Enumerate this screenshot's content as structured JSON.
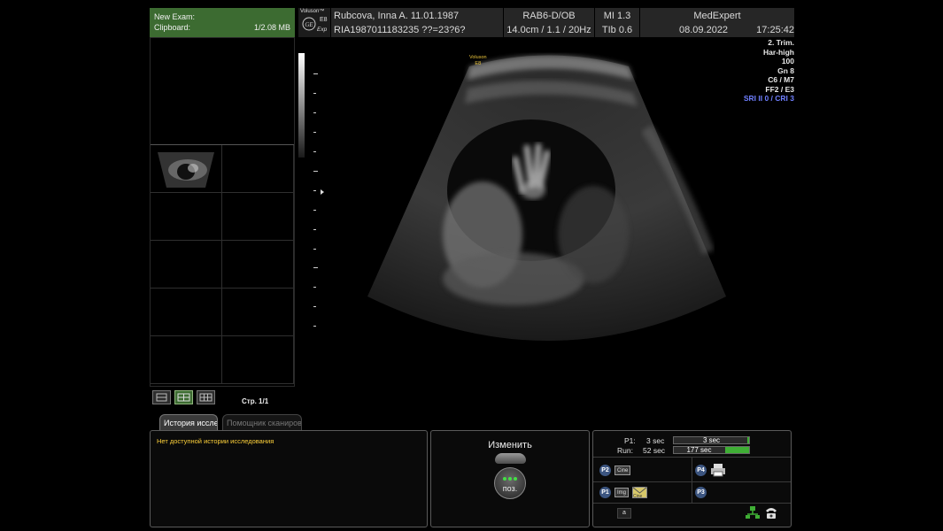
{
  "clipboard": {
    "title": "New Exam:",
    "label": "Clipboard:",
    "size": "1/2.08 MB",
    "page_label": "Стр. 1/1"
  },
  "header": {
    "brand": "Voluson™",
    "model": "E8",
    "model_sub": "Exp",
    "patient_name": "Rubcova, Inna A.  11.01.1987",
    "patient_id": "RIA1987011183235  ??=23?6?",
    "probe": "RAB6-D/OB",
    "depth": "14.0cm / 1.1 / 20Hz",
    "mi": "MI  1.3",
    "tib": "TIb  0.6",
    "institution": "MedExpert",
    "date": "08.09.2022",
    "time": "17:25:42"
  },
  "params": {
    "p1": "2. Trim.",
    "p2": "Har-high",
    "p3": "100",
    "p4": "Gn   8",
    "p5": "C6 / M7",
    "p6": "FF2 / E3",
    "p7": "SRI II 0 / CRI 3"
  },
  "image_label": {
    "l1": "Voluson",
    "l2": "E8"
  },
  "tabs": {
    "history": "История исслед",
    "helper": "Помощник сканиров"
  },
  "history": {
    "message": "Нет доступной истории исследования"
  },
  "change": {
    "title": "Изменить",
    "knob": "поз."
  },
  "info": {
    "p1_label": "P1:",
    "p1_val": "3 sec",
    "p1_bar": "3 sec",
    "run_label": "Run:",
    "run_val": "52 sec",
    "run_bar": "177 sec",
    "btn_p2": "P2",
    "btn_p4": "P4",
    "btn_p1": "P1",
    "btn_p3": "P3",
    "chip_cine": "Cine",
    "chip_img": "Img",
    "chip_cine2": "Cine",
    "chip_a": "a"
  },
  "colors": {
    "clipboard_green": "#3c6b31",
    "status_green": "#3fae35",
    "param_blue": "#6f7fff"
  }
}
